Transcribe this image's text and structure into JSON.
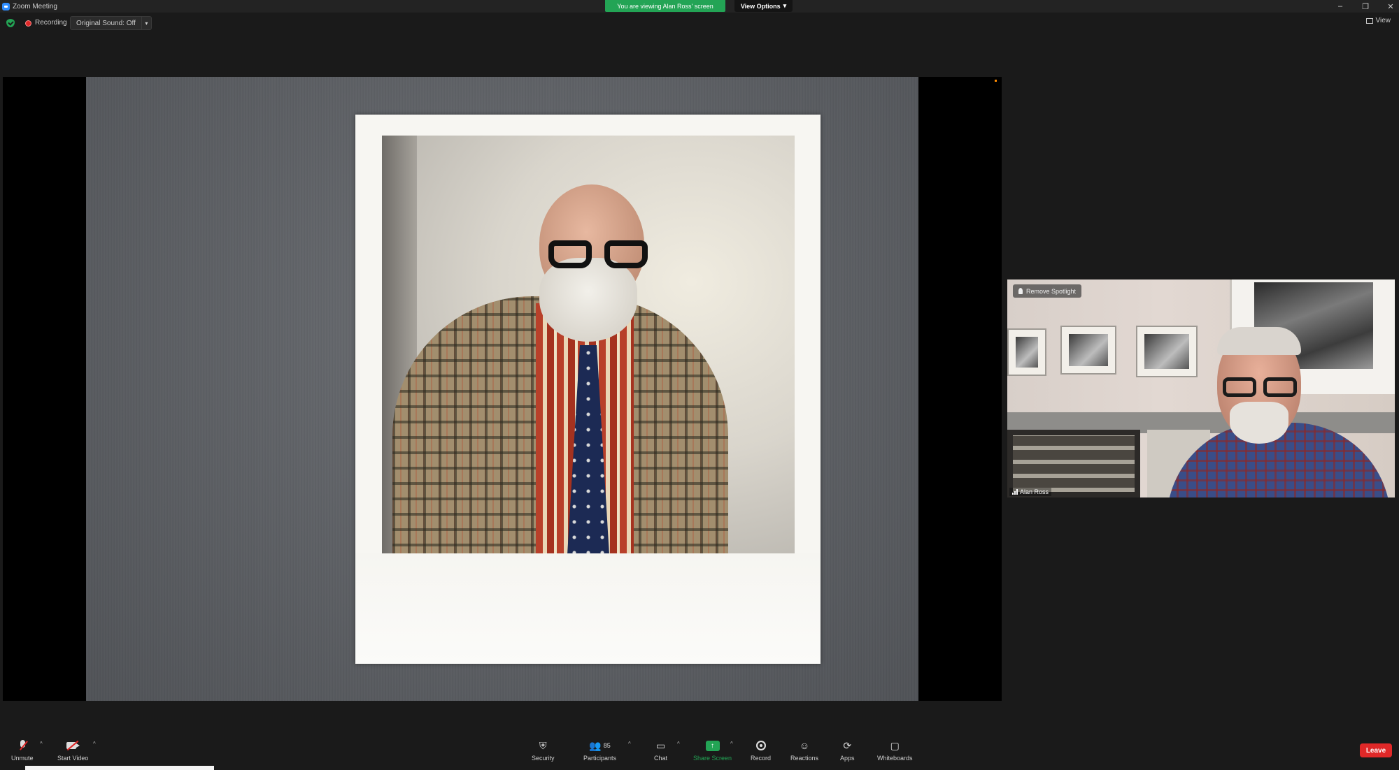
{
  "window": {
    "title": "Zoom Meeting",
    "controls": {
      "minimize": "–",
      "restore": "❐",
      "close": "✕"
    }
  },
  "banner": {
    "viewing_text": "You are viewing Alan Ross' screen",
    "view_options_label": "View Options",
    "view_options_caret": "▾"
  },
  "status": {
    "recording_label": "Recording",
    "original_sound_label": "Original Sound: Off",
    "original_sound_caret": "▾",
    "view_label": "View"
  },
  "tile": {
    "remove_spotlight_label": "Remove Spotlight",
    "participant_name": "Alan Ross"
  },
  "toolbar": {
    "unmute_label": "Unmute",
    "start_video_label": "Start Video",
    "security_label": "Security",
    "participants_label": "Participants",
    "participants_count": "85",
    "chat_label": "Chat",
    "share_screen_label": "Share Screen",
    "record_label": "Record",
    "reactions_label": "Reactions",
    "apps_label": "Apps",
    "whiteboards_label": "Whiteboards",
    "leave_label": "Leave",
    "caret": "^"
  },
  "colors": {
    "accent_green": "#23a455",
    "leave_red": "#e02828",
    "zoom_blue": "#2d8cff",
    "background": "#1a1a1a"
  },
  "icons": [
    "zoom-app-icon",
    "shield-check-icon",
    "record-dot-icon",
    "view-grid-icon",
    "pin-icon",
    "signal-bars-icon",
    "mic-muted-icon",
    "camera-off-icon",
    "security-shield-icon",
    "participants-icon",
    "chat-icon",
    "share-screen-icon",
    "record-icon",
    "reactions-icon",
    "apps-icon",
    "whiteboard-icon"
  ]
}
